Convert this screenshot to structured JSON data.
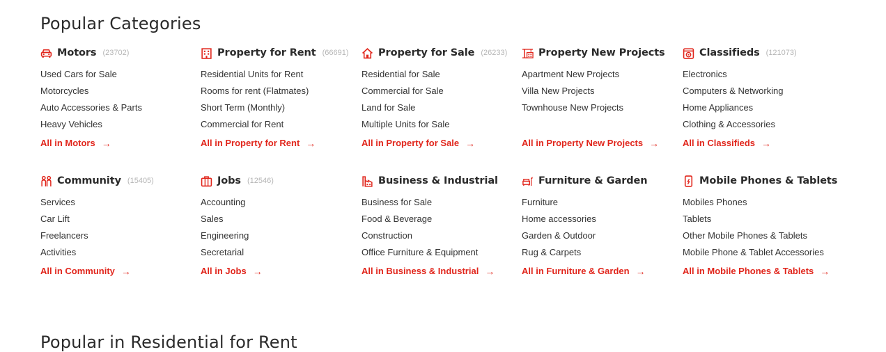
{
  "popular_title": "Popular Categories",
  "bottom_title": "Popular in Residential for Rent",
  "accent_color": "#e1261c",
  "arrow_glyph": "→",
  "rows": [
    [
      {
        "icon": "car-icon",
        "title": "Motors",
        "count": "(23702)",
        "items": [
          "Used Cars for Sale",
          "Motorcycles",
          "Auto Accessories & Parts",
          "Heavy Vehicles"
        ],
        "all": "All in Motors"
      },
      {
        "icon": "building-icon",
        "title": "Property for Rent",
        "count": "(66691)",
        "items": [
          "Residential Units for Rent",
          "Rooms for rent (Flatmates)",
          "Short Term (Monthly)",
          "Commercial for Rent"
        ],
        "all": "All in Property for Rent"
      },
      {
        "icon": "house-icon",
        "title": "Property for Sale",
        "count": "(26233)",
        "items": [
          "Residential for Sale",
          "Commercial for Sale",
          "Land for Sale",
          "Multiple Units for Sale"
        ],
        "all": "All in Property for Sale"
      },
      {
        "icon": "crane-icon",
        "title": "Property New Projects",
        "count": "",
        "items": [
          "Apartment New Projects",
          "Villa New Projects",
          "Townhouse New Projects"
        ],
        "all": "All in Property New Projects"
      },
      {
        "icon": "classifieds-icon",
        "title": "Classifieds",
        "count": "(121073)",
        "items": [
          "Electronics",
          "Computers & Networking",
          "Home Appliances",
          "Clothing & Accessories"
        ],
        "all": "All in Classifieds"
      }
    ],
    [
      {
        "icon": "community-icon",
        "title": "Community",
        "count": "(15405)",
        "items": [
          "Services",
          "Car Lift",
          "Freelancers",
          "Activities"
        ],
        "all": "All in Community"
      },
      {
        "icon": "briefcase-icon",
        "title": "Jobs",
        "count": "(12546)",
        "items": [
          "Accounting",
          "Sales",
          "Engineering",
          "Secretarial"
        ],
        "all": "All in Jobs"
      },
      {
        "icon": "factory-icon",
        "title": "Business & Industrial",
        "count": "",
        "items": [
          "Business for Sale",
          "Food & Beverage",
          "Construction",
          "Office Furniture & Equipment"
        ],
        "all": "All in Business & Industrial"
      },
      {
        "icon": "furniture-icon",
        "title": "Furniture & Garden",
        "count": "",
        "items": [
          "Furniture",
          "Home accessories",
          "Garden & Outdoor",
          "Rug & Carpets"
        ],
        "all": "All in Furniture & Garden"
      },
      {
        "icon": "mobile-phone-icon",
        "title": "Mobile Phones & Tablets",
        "count": "",
        "items": [
          "Mobiles Phones",
          "Tablets",
          "Other Mobile Phones & Tablets",
          "Mobile Phone & Tablet Accessories"
        ],
        "all": "All in Mobile Phones & Tablets"
      }
    ]
  ]
}
